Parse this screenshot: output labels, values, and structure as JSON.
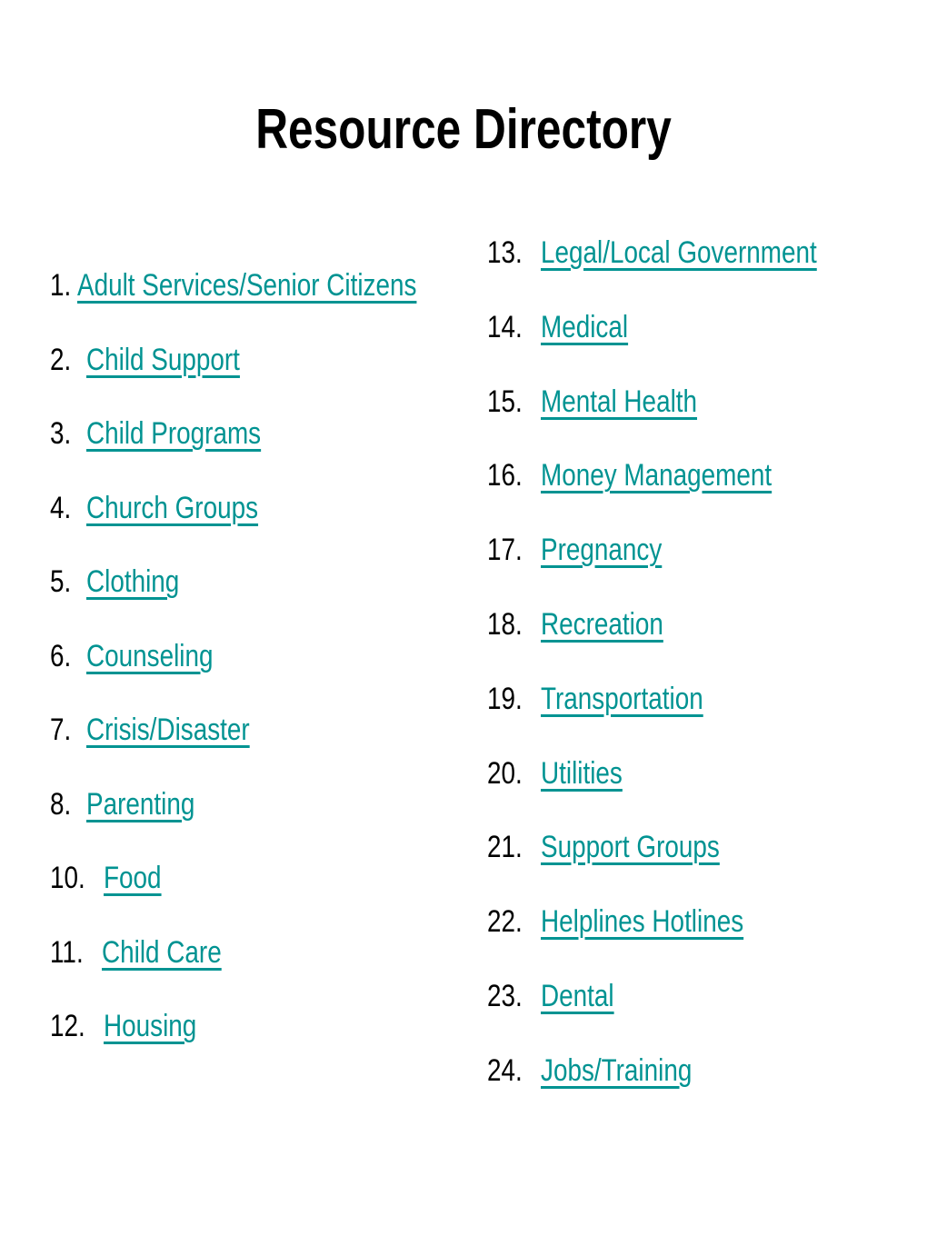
{
  "document": {
    "title": "Resource Directory",
    "background_color": "#ffffff",
    "link_color": "#009392",
    "number_color": "#000000",
    "title_color": "#000000"
  },
  "columns": {
    "left": {
      "items": [
        {
          "number": "1.",
          "label": "Adult Services/Senior Citizens",
          "spacing": "tight"
        },
        {
          "number": "2.",
          "label": "Child Support",
          "spacing": "normal"
        },
        {
          "number": "3.",
          "label": "Child Programs",
          "spacing": "normal"
        },
        {
          "number": "4.",
          "label": "Church Groups",
          "spacing": "normal"
        },
        {
          "number": "5.",
          "label": "Clothing",
          "spacing": "normal"
        },
        {
          "number": "6.",
          "label": "Counseling",
          "spacing": "normal"
        },
        {
          "number": "7.",
          "label": "Crisis/Disaster",
          "spacing": "normal"
        },
        {
          "number": "8.",
          "label": "Parenting",
          "spacing": "normal"
        },
        {
          "number": "10.",
          "label": "Food",
          "spacing": "normal"
        },
        {
          "number": "11.",
          "label": "Child Care",
          "spacing": "normal"
        },
        {
          "number": "12.",
          "label": "Housing",
          "spacing": "normal"
        }
      ]
    },
    "right": {
      "items": [
        {
          "number": "13.",
          "label": "Legal/Local Government",
          "spacing": "normal"
        },
        {
          "number": "14.",
          "label": "Medical",
          "spacing": "normal"
        },
        {
          "number": "15.",
          "label": "Mental Health",
          "spacing": "normal"
        },
        {
          "number": "16.",
          "label": "Money Management",
          "spacing": "normal"
        },
        {
          "number": "17.",
          "label": "Pregnancy",
          "spacing": "normal"
        },
        {
          "number": "18.",
          "label": "Recreation",
          "spacing": "normal"
        },
        {
          "number": "19.",
          "label": "Transportation",
          "spacing": "normal"
        },
        {
          "number": "20.",
          "label": "Utilities",
          "spacing": "normal"
        },
        {
          "number": "21.",
          "label": "Support Groups",
          "spacing": "normal"
        },
        {
          "number": "22.",
          "label": "Helplines Hotlines",
          "spacing": "normal"
        },
        {
          "number": "23.",
          "label": "Dental",
          "spacing": "normal"
        },
        {
          "number": "24.",
          "label": "Jobs/Training",
          "spacing": "normal"
        }
      ]
    }
  }
}
